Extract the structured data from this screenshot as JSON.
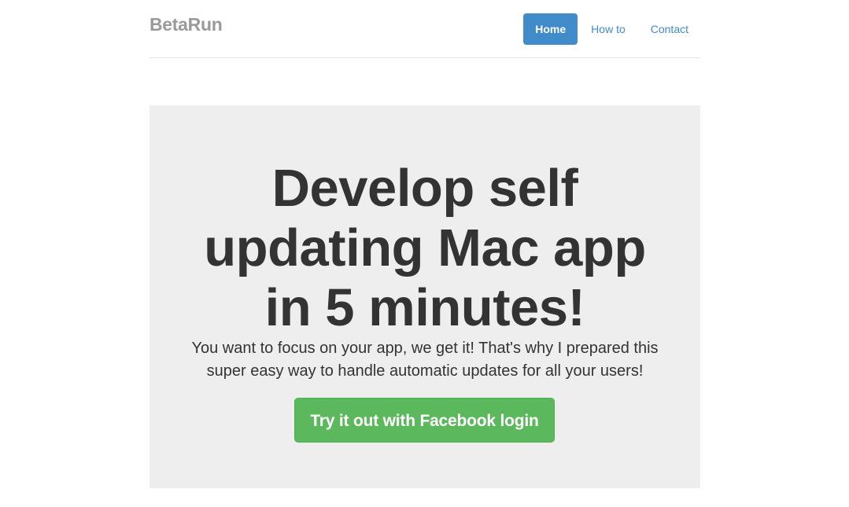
{
  "header": {
    "brand": "BetaRun",
    "nav": [
      {
        "label": "Home",
        "active": true
      },
      {
        "label": "How to",
        "active": false
      },
      {
        "label": "Contact",
        "active": false
      }
    ]
  },
  "hero": {
    "headline": "Develop self updating Mac app in 5 minutes!",
    "lead": "You want to focus on your app, we get it! That's why I prepared this super easy way to handle automatic updates for all your users!",
    "cta_label": "Try it out with Facebook login"
  },
  "colors": {
    "primary": "#428bca",
    "success": "#5cb85c",
    "jumbotron_bg": "#eeeeee",
    "brand_text": "#9a9a9a"
  }
}
